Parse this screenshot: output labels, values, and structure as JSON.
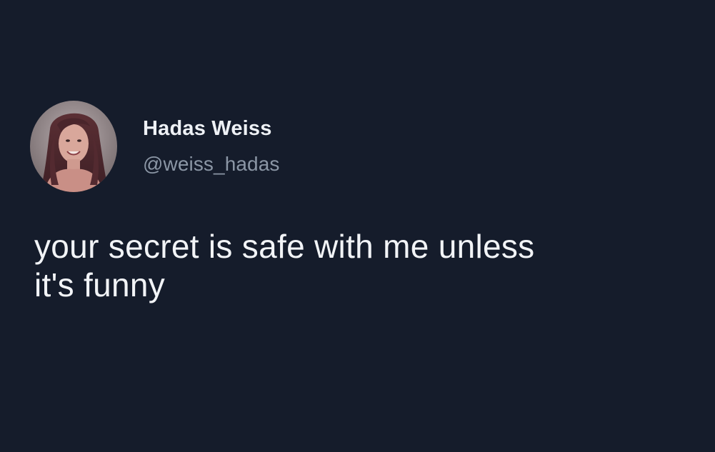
{
  "author": {
    "display_name": "Hadas Weiss",
    "handle": "@weiss_hadas",
    "avatar_icon": "profile-photo"
  },
  "tweet": {
    "text": "your secret is safe with me unless\nit's funny"
  },
  "colors": {
    "background": "#151c2b",
    "name_text": "#eef1f5",
    "handle_text": "#8b96a5",
    "body_text": "#f2f4f7"
  }
}
